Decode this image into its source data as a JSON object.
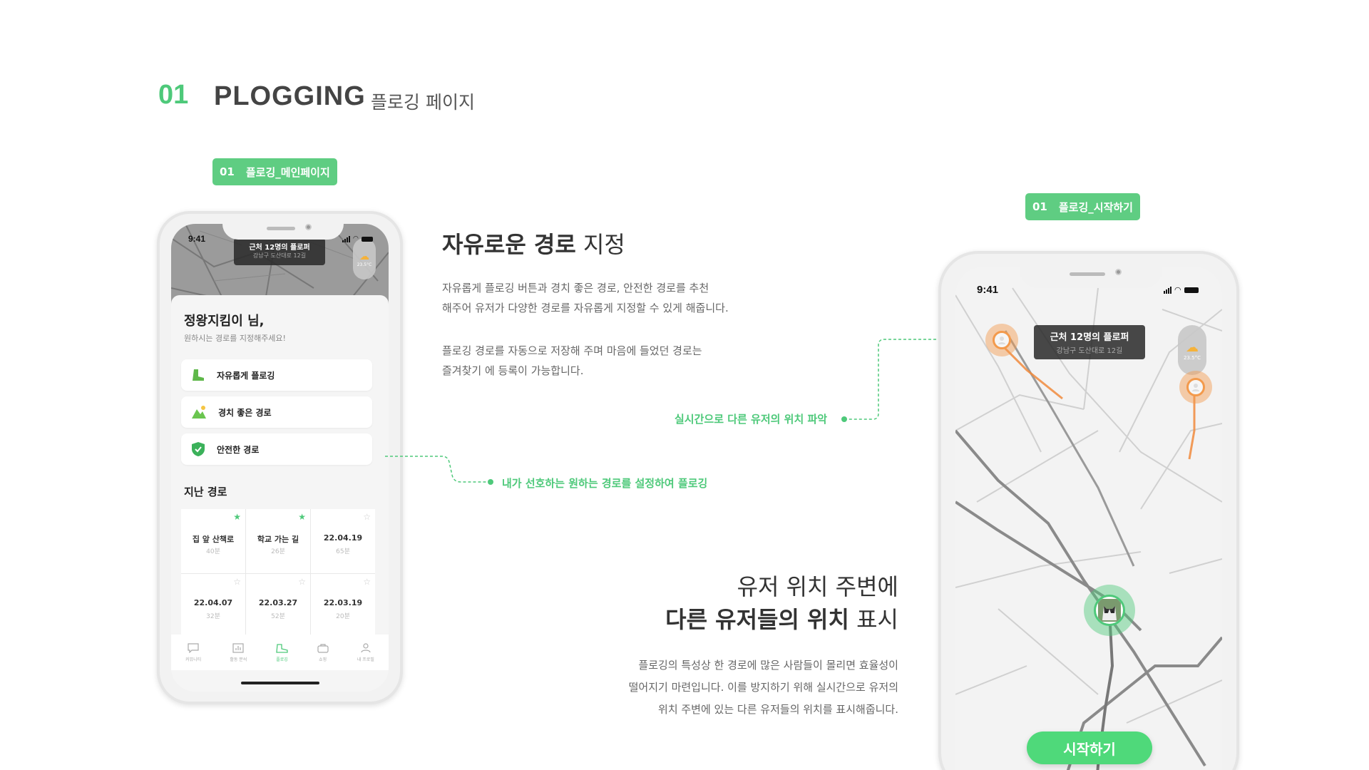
{
  "section": {
    "number": "01",
    "title": "PLOGGING",
    "subtitle": "플로깅 페이지"
  },
  "tags": {
    "main_num": "01",
    "main_label": "플로깅_메인페이지",
    "start_num": "01",
    "start_label": "플로깅_시작하기"
  },
  "left_phone": {
    "time": "9:41",
    "callout_title": "근처 12명의 플로퍼",
    "callout_sub": "강남구 도산대로 12길",
    "weather_temp": "23.5°C",
    "greeting": "정왕지킴이 님,",
    "greeting_sub": "원하시는 경로를 지정해주세요!",
    "options": [
      {
        "label": "자유롭게 플로깅",
        "icon": "sneaker-icon"
      },
      {
        "label": "경치 좋은 경로",
        "icon": "mountain-icon"
      },
      {
        "label": "안전한 경로",
        "icon": "shield-check-icon"
      }
    ],
    "past_title": "지난 경로",
    "past_routes": [
      {
        "name": "집 앞 산책로",
        "minutes": "40분",
        "starred": true
      },
      {
        "name": "학교 가는 길",
        "minutes": "26분",
        "starred": true
      },
      {
        "name": "22.04.19",
        "minutes": "65분",
        "starred": false
      },
      {
        "name": "22.04.07",
        "minutes": "32분",
        "starred": false
      },
      {
        "name": "22.03.27",
        "minutes": "52분",
        "starred": false
      },
      {
        "name": "22.03.19",
        "minutes": "20분",
        "starred": false
      }
    ],
    "tabs": [
      {
        "label": "커뮤니티",
        "icon": "chat-icon"
      },
      {
        "label": "활동 분석",
        "icon": "chart-icon"
      },
      {
        "label": "플로깅",
        "icon": "plogging-icon"
      },
      {
        "label": "쇼핑",
        "icon": "bag-icon"
      },
      {
        "label": "내 프로필",
        "icon": "person-icon"
      }
    ]
  },
  "free_route": {
    "title_bold": "자유로운 경로",
    "title_rest": " 지정",
    "para1_line1": "자유롭게 플로깅 버튼과 경치 좋은 경로, 안전한 경로를 추천",
    "para1_line2": "해주어 유저가 다양한 경로를 자유롭게 지정할 수 있게 해줍니다.",
    "para2_line1": "플로깅 경로를 자동으로 저장해 주며 마음에 들었던 경로는",
    "para2_line2": "즐겨찾기 에 등록이 가능합니다."
  },
  "annotations": {
    "realtime": "실시간으로 다른 유저의 위치 파악",
    "preferred": "내가 선호하는 원하는 경로를 설정하여 플로깅"
  },
  "user_location": {
    "title_line1": "유저 위치 주변에",
    "title_bold": "다른 유저들의 위치",
    "title_rest": " 표시",
    "para_line1": "플로깅의 특성상 한 경로에 많은 사람들이 몰리면 효율성이",
    "para_line2": "떨어지기 마련입니다. 이를 방지하기 위해 실시간으로 유저의",
    "para_line3": "위치 주변에 있는 다른 유저들의 위치를 표시해줍니다."
  },
  "right_phone": {
    "time": "9:41",
    "callout_title": "근처 12명의 플로퍼",
    "callout_sub": "강남구 도산대로 12길",
    "weather_temp": "23.5°C",
    "start_label": "시작하기"
  },
  "colors": {
    "accent": "#4ec97a",
    "user_orange": "#f39a4c"
  }
}
